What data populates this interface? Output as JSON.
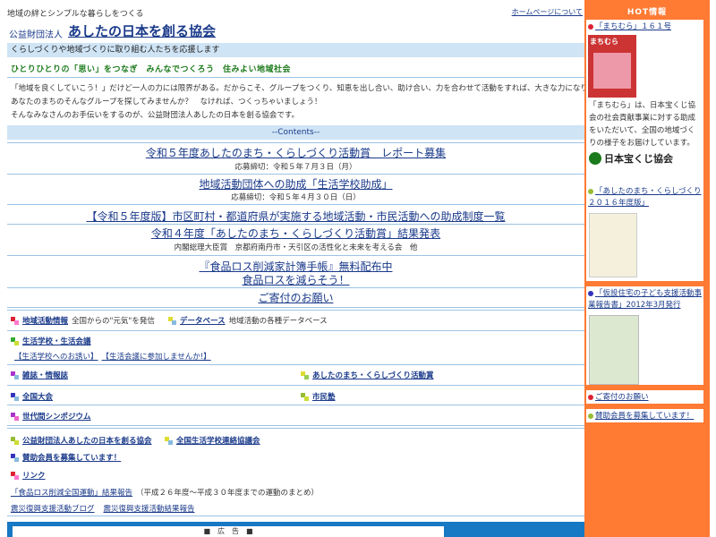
{
  "header": {
    "tagline": "地域の絆とシンプルな暮らしをつくる",
    "home_link": "ホームページについて",
    "org_kind": "公益財団法人",
    "org_name": "あしたの日本を創る協会",
    "subtitle": "くらしづくりや地域づくりに取り組む人たちを応援します",
    "slogan": "ひとりひとりの「思い」をつなぎ　みんなでつくろう　住みよい地域社会"
  },
  "intro": [
    "「地域を良くしていこう！」だけど一人の力には限界がある。だからこそ、グループをつくり、知恵を出し合い、助け合い、力を合わせて活動をすれば、大きな力になります。",
    "あなたのまちのそんなグループを探してみませんか？　なければ、つくっちゃいましょう！",
    "そんなみなさんのお手伝いをするのが、公益財団法人あしたの日本を創る協会です。"
  ],
  "contents": {
    "header": "--Contents--",
    "items": [
      {
        "title": "令和５年度あしたのまち・くらしづくり活動賞　レポート募集",
        "sub": "応募締切：令和５年７月３日（月）"
      },
      {
        "title": "地域活動団体への助成「生活学校助成」",
        "sub": "応募締切：令和５年４月３０日（日）"
      },
      {
        "title": "【令和５年度版】市区町村・都道府県が実施する地域活動・市民活動への助成制度一覧",
        "sub": ""
      },
      {
        "title": "令和４年度「あしたのまち・くらしづくり活動賞」結果発表",
        "sub": "内閣総理大臣賞　京都府南丹市・天引区の活性化と未来を考える会　他"
      },
      {
        "title": "『食品ロス削減家計簿手帳』無料配布中",
        "sub": ""
      },
      {
        "title": "食品ロスを減らそう！",
        "sub": ""
      },
      {
        "title": "ご寄付のお願い",
        "sub": ""
      }
    ]
  },
  "links": {
    "chiiki": "地域活動情報",
    "chiiki_desc": "全国からの\"元気\"を発信",
    "database": "データベース",
    "database_desc": "地域活動の各種データベース",
    "seikatsu": "生活学校・生活会議",
    "seikatsu_sub1": "【生活学校へのお誘い】",
    "seikatsu_sub2": "【生活会議に参加しませんか!】",
    "zasshi": "雑誌・情報誌",
    "ashita": "あしたのまち・くらしづくり活動賞",
    "zenkoku": "全国大会",
    "shimin": "市民塾",
    "sedai": "世代間シンポジウム",
    "koeki": "公益財団法人あしたの日本を創る協会",
    "renraku": "全国生活学校連絡協議会",
    "sanjo": "賛助会員を募集しています！",
    "link": "リンク",
    "report": "「食品ロス削減全国運動」結果報告",
    "report_desc": "（平成２６年度〜平成３０年度までの運動のまとめ）",
    "blog": "震災復興支援活動ブログ",
    "report2": "震災復興支援活動結果報告"
  },
  "ad": {
    "label": "■　広　告　■"
  },
  "sidebar": {
    "title": "HOT情報",
    "cards": [
      {
        "title": "「まちむら」１６１号",
        "desc": "「まちむら」は、日本宝くじ協会の社会貢献事業に対する助成をいただいて、全国の地域づくりの様子をお届けしています。",
        "logo": "日本宝くじ協会",
        "cover_title": "まちむら"
      },
      {
        "title": "「あしたのまち・くらしづくり２０１６年度版」"
      },
      {
        "title": "「仮設住宅の子ども支援活動事業報告書」2012年3月発行"
      },
      {
        "title": "ご寄付のお願い"
      },
      {
        "title": "賛助会員を募集しています！"
      }
    ]
  },
  "colors": {
    "band": "#cfe4f5",
    "link": "#1a3a8a",
    "green": "#1b7a1b",
    "sidebar": "#ff7a33",
    "adbar": "#1778c4"
  }
}
